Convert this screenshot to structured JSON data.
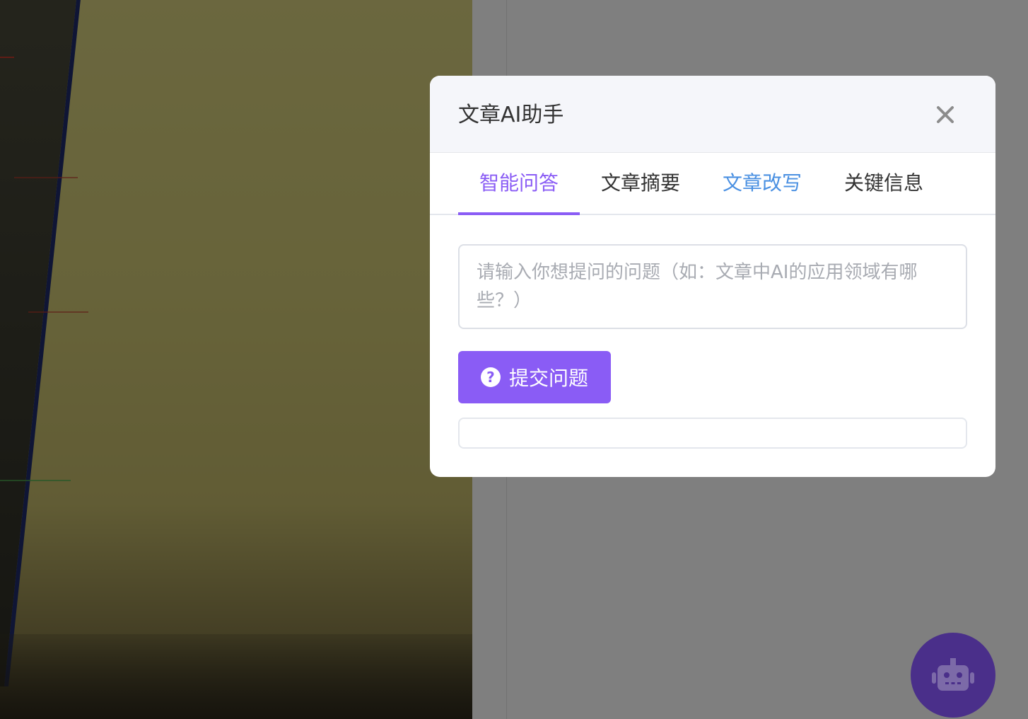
{
  "modal": {
    "title": "文章AI助手",
    "close_icon": "close-icon"
  },
  "tabs": [
    {
      "label": "智能问答",
      "state": "active"
    },
    {
      "label": "文章摘要",
      "state": "normal"
    },
    {
      "label": "文章改写",
      "state": "hover"
    },
    {
      "label": "关键信息",
      "state": "normal"
    }
  ],
  "question": {
    "placeholder": "请输入你想提问的问题（如：文章中AI的应用领域有哪些？）",
    "value": ""
  },
  "submit": {
    "label": "提交问题",
    "icon": "question-circle-icon"
  },
  "answer": {
    "text": ""
  },
  "fab": {
    "icon": "robot-icon"
  },
  "colors": {
    "accent": "#8a5cf5",
    "tab_hover": "#4a90e2",
    "fab_bg": "#4a2f8a"
  }
}
